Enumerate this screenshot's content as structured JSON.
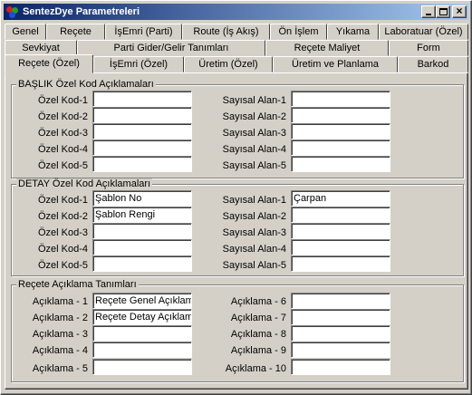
{
  "window": {
    "title": "SentezDye Parametreleri"
  },
  "tabs_row1": [
    "Genel",
    "Reçete",
    "İşEmri (Parti)",
    "Route (İş Akış)",
    "Ön İşlem",
    "Yıkama",
    "Laboratuar (Özel)"
  ],
  "tabs_row2": [
    "Sevkiyat",
    "Parti Gider/Gelir Tanımları",
    "Reçete Maliyet",
    "Form"
  ],
  "tabs_row3": [
    "Reçete (Özel)",
    "İşEmri (Özel)",
    "Üretim (Özel)",
    "Üretim ve Planlama",
    "Barkod"
  ],
  "baslik": {
    "title": "BAŞLIK  Özel Kod Açıklamaları",
    "left_labels": [
      "Özel Kod-1",
      "Özel Kod-2",
      "Özel Kod-3",
      "Özel Kod-4",
      "Özel Kod-5"
    ],
    "left_values": [
      "",
      "",
      "",
      "",
      ""
    ],
    "right_labels": [
      "Sayısal Alan-1",
      "Sayısal Alan-2",
      "Sayısal Alan-3",
      "Sayısal Alan-4",
      "Sayısal Alan-5"
    ],
    "right_values": [
      "",
      "",
      "",
      "",
      ""
    ]
  },
  "detay": {
    "title": "DETAY  Özel Kod Açıklamaları",
    "left_labels": [
      "Özel Kod-1",
      "Özel Kod-2",
      "Özel Kod-3",
      "Özel Kod-4",
      "Özel Kod-5"
    ],
    "left_values": [
      "Şablon No",
      "Şablon Rengi",
      "",
      "",
      ""
    ],
    "right_labels": [
      "Sayısal Alan-1",
      "Sayısal Alan-2",
      "Sayısal Alan-3",
      "Sayısal Alan-4",
      "Sayısal Alan-5"
    ],
    "right_values": [
      "Çarpan",
      "",
      "",
      "",
      ""
    ]
  },
  "recete": {
    "title": "Reçete Açıklama Tanımları",
    "left_labels": [
      "Açıklama - 1",
      "Açıklama - 2",
      "Açıklama - 3",
      "Açıklama - 4",
      "Açıklama - 5"
    ],
    "left_values": [
      "Reçete Genel Açıklama",
      "Reçete Detay Açıklama",
      "",
      "",
      ""
    ],
    "right_labels": [
      "Açıklama - 6",
      "Açıklama - 7",
      "Açıklama - 8",
      "Açıklama - 9",
      "Açıklama - 10"
    ],
    "right_values": [
      "",
      "",
      "",
      "",
      ""
    ]
  }
}
